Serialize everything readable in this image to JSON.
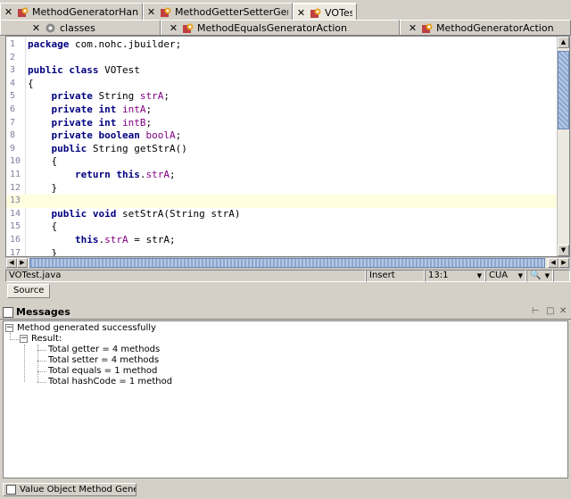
{
  "tabs_row1": [
    {
      "label": "MethodGeneratorHandler",
      "active": false
    },
    {
      "label": "MethodGetterSetterGenerat...",
      "active": false
    },
    {
      "label": "VOTest",
      "active": true
    }
  ],
  "tabs_row2": [
    {
      "label": "classes"
    },
    {
      "label": "MethodEqualsGeneratorAction"
    },
    {
      "label": "MethodGeneratorAction"
    }
  ],
  "editor": {
    "lines": [
      {
        "n": "1",
        "code": "package com.nohc.jbuilder;"
      },
      {
        "n": "2",
        "code": ""
      },
      {
        "n": "3",
        "code": "public class VOTest"
      },
      {
        "n": "4",
        "code": "{"
      },
      {
        "n": "5",
        "code": "    private String strA;"
      },
      {
        "n": "6",
        "code": "    private int intA;"
      },
      {
        "n": "7",
        "code": "    private int intB;"
      },
      {
        "n": "8",
        "code": "    private boolean boolA;"
      },
      {
        "n": "9",
        "code": "    public String getStrA()"
      },
      {
        "n": "10",
        "code": "    {"
      },
      {
        "n": "11",
        "code": "        return this.strA;"
      },
      {
        "n": "12",
        "code": "    }"
      },
      {
        "n": "13",
        "code": ""
      },
      {
        "n": "14",
        "code": "    public void setStrA(String strA)"
      },
      {
        "n": "15",
        "code": "    {"
      },
      {
        "n": "16",
        "code": "        this.strA = strA;"
      },
      {
        "n": "17",
        "code": "    }"
      }
    ]
  },
  "status": {
    "file": "VOTest.java",
    "mode": "Insert",
    "position": "13:1",
    "keymap": "CUA"
  },
  "source_tab": "Source",
  "messages": {
    "title": "Messages",
    "root": "Method generated successfully",
    "result_label": "Result:",
    "items": [
      "Total getter = 4 methods",
      "Total setter = 4 methods",
      "Total equals = 1 method",
      "Total hashCode = 1 method"
    ]
  },
  "bottom_tab": "Value Object Method Gener..."
}
